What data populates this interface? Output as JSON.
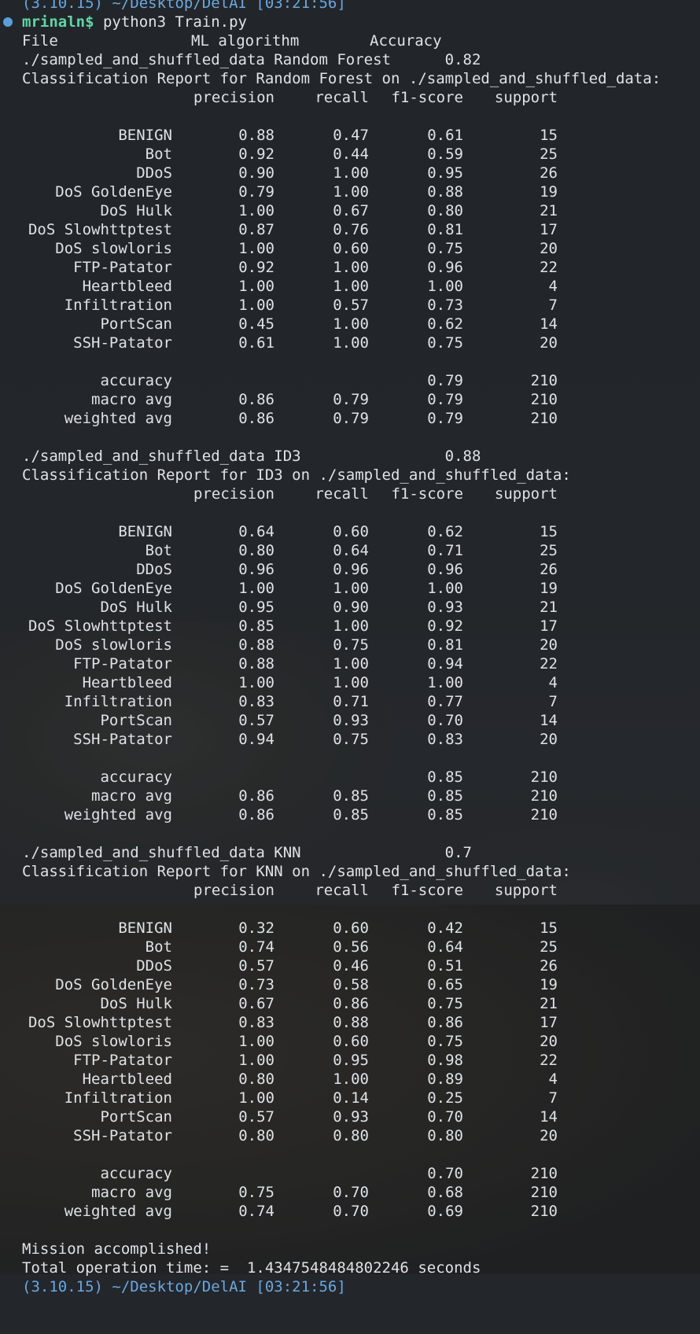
{
  "terminal": {
    "top_fragment": "(3.10.15) ~/Desktop/DelAI [03:21:56]",
    "prompt": {
      "user": "mrinaln$",
      "command": " python3 Train.py"
    },
    "summary_header": {
      "file": "File",
      "algorithm": "ML algorithm",
      "accuracy": "Accuracy"
    },
    "report_headers": {
      "precision": "precision",
      "recall": "recall",
      "f1": "f1-score",
      "support": "support"
    },
    "reports": [
      {
        "summary_line": "./sampled_and_shuffled_data Random Forest      0.82",
        "title": "Classification Report for Random Forest on ./sampled_and_shuffled_data:",
        "rows": [
          {
            "label": "BENIGN",
            "p": "0.88",
            "r": "0.47",
            "f": "0.61",
            "s": "15"
          },
          {
            "label": "Bot",
            "p": "0.92",
            "r": "0.44",
            "f": "0.59",
            "s": "25"
          },
          {
            "label": "DDoS",
            "p": "0.90",
            "r": "1.00",
            "f": "0.95",
            "s": "26"
          },
          {
            "label": "DoS GoldenEye",
            "p": "0.79",
            "r": "1.00",
            "f": "0.88",
            "s": "19"
          },
          {
            "label": "DoS Hulk",
            "p": "1.00",
            "r": "0.67",
            "f": "0.80",
            "s": "21"
          },
          {
            "label": "DoS Slowhttptest",
            "p": "0.87",
            "r": "0.76",
            "f": "0.81",
            "s": "17"
          },
          {
            "label": "DoS slowloris",
            "p": "1.00",
            "r": "0.60",
            "f": "0.75",
            "s": "20"
          },
          {
            "label": "FTP-Patator",
            "p": "0.92",
            "r": "1.00",
            "f": "0.96",
            "s": "22"
          },
          {
            "label": "Heartbleed",
            "p": "1.00",
            "r": "1.00",
            "f": "1.00",
            "s": "4"
          },
          {
            "label": "Infiltration",
            "p": "1.00",
            "r": "0.57",
            "f": "0.73",
            "s": "7"
          },
          {
            "label": "PortScan",
            "p": "0.45",
            "r": "1.00",
            "f": "0.62",
            "s": "14"
          },
          {
            "label": "SSH-Patator",
            "p": "0.61",
            "r": "1.00",
            "f": "0.75",
            "s": "20"
          }
        ],
        "accuracy": {
          "label": "accuracy",
          "f": "0.79",
          "s": "210"
        },
        "macro": {
          "label": "macro avg",
          "p": "0.86",
          "r": "0.79",
          "f": "0.79",
          "s": "210"
        },
        "weighted": {
          "label": "weighted avg",
          "p": "0.86",
          "r": "0.79",
          "f": "0.79",
          "s": "210"
        }
      },
      {
        "summary_line": "./sampled_and_shuffled_data ID3                0.88",
        "title": "Classification Report for ID3 on ./sampled_and_shuffled_data:",
        "rows": [
          {
            "label": "BENIGN",
            "p": "0.64",
            "r": "0.60",
            "f": "0.62",
            "s": "15"
          },
          {
            "label": "Bot",
            "p": "0.80",
            "r": "0.64",
            "f": "0.71",
            "s": "25"
          },
          {
            "label": "DDoS",
            "p": "0.96",
            "r": "0.96",
            "f": "0.96",
            "s": "26"
          },
          {
            "label": "DoS GoldenEye",
            "p": "1.00",
            "r": "1.00",
            "f": "1.00",
            "s": "19"
          },
          {
            "label": "DoS Hulk",
            "p": "0.95",
            "r": "0.90",
            "f": "0.93",
            "s": "21"
          },
          {
            "label": "DoS Slowhttptest",
            "p": "0.85",
            "r": "1.00",
            "f": "0.92",
            "s": "17"
          },
          {
            "label": "DoS slowloris",
            "p": "0.88",
            "r": "0.75",
            "f": "0.81",
            "s": "20"
          },
          {
            "label": "FTP-Patator",
            "p": "0.88",
            "r": "1.00",
            "f": "0.94",
            "s": "22"
          },
          {
            "label": "Heartbleed",
            "p": "1.00",
            "r": "1.00",
            "f": "1.00",
            "s": "4"
          },
          {
            "label": "Infiltration",
            "p": "0.83",
            "r": "0.71",
            "f": "0.77",
            "s": "7"
          },
          {
            "label": "PortScan",
            "p": "0.57",
            "r": "0.93",
            "f": "0.70",
            "s": "14"
          },
          {
            "label": "SSH-Patator",
            "p": "0.94",
            "r": "0.75",
            "f": "0.83",
            "s": "20"
          }
        ],
        "accuracy": {
          "label": "accuracy",
          "f": "0.85",
          "s": "210"
        },
        "macro": {
          "label": "macro avg",
          "p": "0.86",
          "r": "0.85",
          "f": "0.85",
          "s": "210"
        },
        "weighted": {
          "label": "weighted avg",
          "p": "0.86",
          "r": "0.85",
          "f": "0.85",
          "s": "210"
        }
      },
      {
        "summary_line": "./sampled_and_shuffled_data KNN                0.7",
        "title": "Classification Report for KNN on ./sampled_and_shuffled_data:",
        "rows": [
          {
            "label": "BENIGN",
            "p": "0.32",
            "r": "0.60",
            "f": "0.42",
            "s": "15"
          },
          {
            "label": "Bot",
            "p": "0.74",
            "r": "0.56",
            "f": "0.64",
            "s": "25"
          },
          {
            "label": "DDoS",
            "p": "0.57",
            "r": "0.46",
            "f": "0.51",
            "s": "26"
          },
          {
            "label": "DoS GoldenEye",
            "p": "0.73",
            "r": "0.58",
            "f": "0.65",
            "s": "19"
          },
          {
            "label": "DoS Hulk",
            "p": "0.67",
            "r": "0.86",
            "f": "0.75",
            "s": "21"
          },
          {
            "label": "DoS Slowhttptest",
            "p": "0.83",
            "r": "0.88",
            "f": "0.86",
            "s": "17"
          },
          {
            "label": "DoS slowloris",
            "p": "1.00",
            "r": "0.60",
            "f": "0.75",
            "s": "20"
          },
          {
            "label": "FTP-Patator",
            "p": "1.00",
            "r": "0.95",
            "f": "0.98",
            "s": "22"
          },
          {
            "label": "Heartbleed",
            "p": "0.80",
            "r": "1.00",
            "f": "0.89",
            "s": "4"
          },
          {
            "label": "Infiltration",
            "p": "1.00",
            "r": "0.14",
            "f": "0.25",
            "s": "7"
          },
          {
            "label": "PortScan",
            "p": "0.57",
            "r": "0.93",
            "f": "0.70",
            "s": "14"
          },
          {
            "label": "SSH-Patator",
            "p": "0.80",
            "r": "0.80",
            "f": "0.80",
            "s": "20"
          }
        ],
        "accuracy": {
          "label": "accuracy",
          "f": "0.70",
          "s": "210"
        },
        "macro": {
          "label": "macro avg",
          "p": "0.75",
          "r": "0.70",
          "f": "0.68",
          "s": "210"
        },
        "weighted": {
          "label": "weighted avg",
          "p": "0.74",
          "r": "0.70",
          "f": "0.69",
          "s": "210"
        }
      }
    ],
    "footer": {
      "mission": "Mission accomplished!",
      "time": "Total operation time: =  1.4347548484802246 seconds",
      "bottom_fragment": "(3.10.15) ~/Desktop/DelAI [03:21:56]"
    }
  },
  "colors": {
    "text": "#dfe2e6",
    "user": "#5fd7a6",
    "prompt_dot": "#5a9fd8",
    "path": "#6aa8e0"
  }
}
